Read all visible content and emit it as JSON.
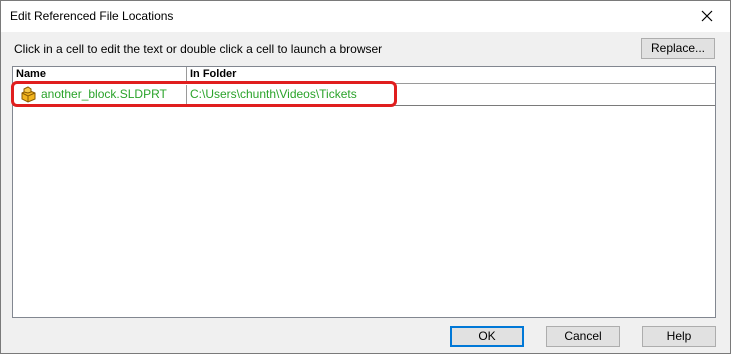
{
  "window": {
    "title": "Edit Referenced File Locations"
  },
  "instructions": "Click in a cell to edit the text or double click a cell to launch a browser",
  "replace_label": "Replace...",
  "grid": {
    "columns": [
      "Name",
      "In Folder"
    ],
    "rows": [
      {
        "name": "another_block.SLDPRT",
        "folder": "C:\\Users\\chunth\\Videos\\Tickets",
        "icon": "sldprt-part-icon"
      }
    ]
  },
  "buttons": {
    "ok": "OK",
    "cancel": "Cancel",
    "help": "Help"
  },
  "colors": {
    "row_text": "#2aa32a",
    "highlight": "#e01e1e",
    "default_button_border": "#0078d7"
  }
}
